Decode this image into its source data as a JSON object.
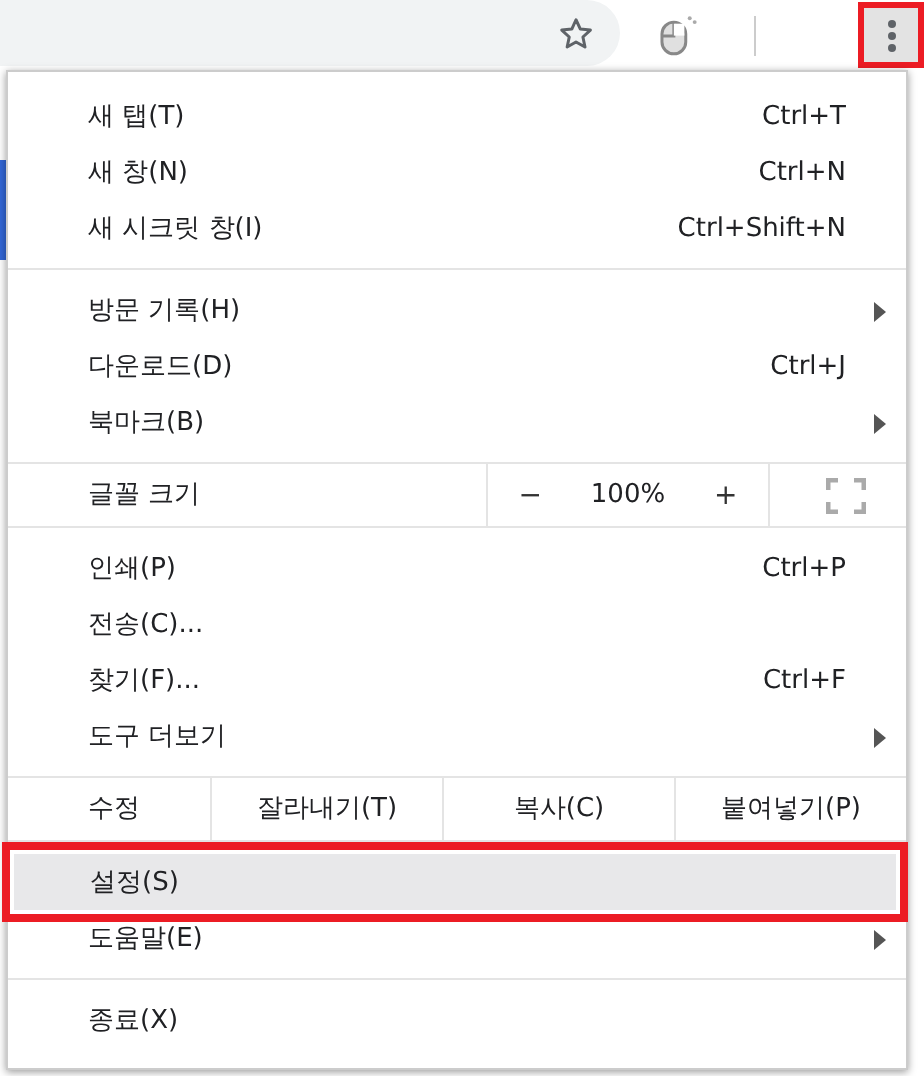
{
  "toolbar": {
    "more_button": {
      "annotated": true
    }
  },
  "menu": {
    "sections": [
      {
        "items": [
          {
            "kind": "item",
            "label": "새 탭(T)",
            "shortcut": "Ctrl+T",
            "submenu": false,
            "highlighted": false,
            "annotated": false
          },
          {
            "kind": "item",
            "label": "새 창(N)",
            "shortcut": "Ctrl+N",
            "submenu": false,
            "highlighted": false,
            "annotated": false
          },
          {
            "kind": "item",
            "label": "새 시크릿 창(I)",
            "shortcut": "Ctrl+Shift+N",
            "submenu": false,
            "highlighted": false,
            "annotated": false
          }
        ]
      },
      {
        "items": [
          {
            "kind": "item",
            "label": "방문 기록(H)",
            "submenu": true,
            "highlighted": false,
            "annotated": false
          },
          {
            "kind": "item",
            "label": "다운로드(D)",
            "shortcut": "Ctrl+J",
            "submenu": false,
            "highlighted": false,
            "annotated": false
          },
          {
            "kind": "item",
            "label": "북마크(B)",
            "submenu": true,
            "highlighted": false,
            "annotated": false
          }
        ]
      },
      {
        "items": [
          {
            "kind": "zoom",
            "label": "글꼴 크기",
            "minus": "−",
            "zoom_value": "100%",
            "plus": "+"
          }
        ]
      },
      {
        "items": [
          {
            "kind": "item",
            "label": "인쇄(P)",
            "shortcut": "Ctrl+P",
            "submenu": false,
            "highlighted": false,
            "annotated": false
          },
          {
            "kind": "item",
            "label": "전송(C)...",
            "submenu": false,
            "highlighted": false,
            "annotated": false
          },
          {
            "kind": "item",
            "label": "찾기(F)...",
            "shortcut": "Ctrl+F",
            "submenu": false,
            "highlighted": false,
            "annotated": false
          },
          {
            "kind": "item",
            "label": "도구 더보기",
            "submenu": true,
            "highlighted": false,
            "annotated": false
          }
        ]
      },
      {
        "items": [
          {
            "kind": "edit",
            "label": "수정",
            "actions": [
              "잘라내기(T)",
              "복사(C)",
              "붙여넣기(P)"
            ]
          }
        ]
      },
      {
        "items": [
          {
            "kind": "item",
            "label": "설정(S)",
            "submenu": false,
            "highlighted": true,
            "annotated": true
          },
          {
            "kind": "item",
            "label": "도움말(E)",
            "submenu": true,
            "highlighted": false,
            "annotated": false
          }
        ]
      },
      {
        "items": [
          {
            "kind": "item",
            "label": "종료(X)",
            "submenu": false,
            "highlighted": false,
            "annotated": false
          }
        ]
      }
    ]
  }
}
